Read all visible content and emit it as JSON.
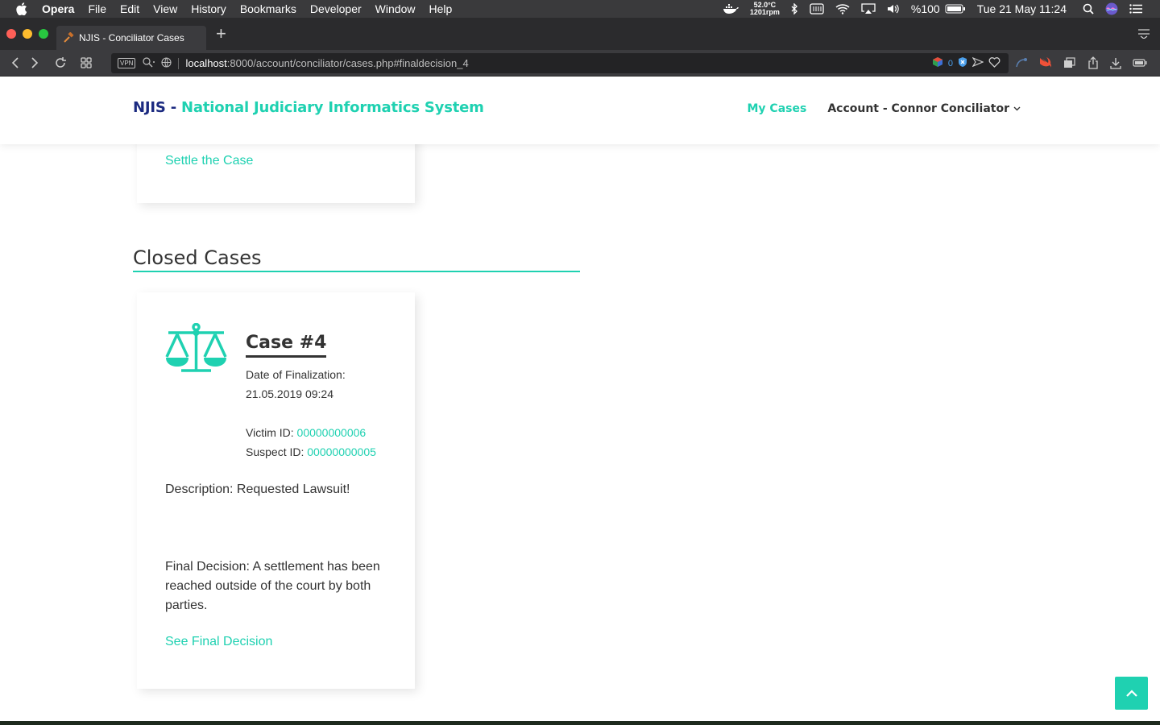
{
  "menubar": {
    "app": "Opera",
    "items": [
      "File",
      "Edit",
      "View",
      "History",
      "Bookmarks",
      "Developer",
      "Window",
      "Help"
    ],
    "temp": "52.0°C",
    "rpm": "1201rpm",
    "battery": "%100",
    "clock": "Tue 21 May  11:24"
  },
  "browser": {
    "tab_title": "NJIS - Conciliator Cases",
    "vpn": "VPN",
    "url_host": "localhost",
    "url_path": ":8000/account/conciliator/cases.php#finaldecision_4",
    "ext_count": "0"
  },
  "site": {
    "brand_short": "NJIS",
    "brand_dash": " - ",
    "brand_full": "National Judiciary Informatics System",
    "nav_my_cases": "My Cases",
    "nav_account": "Account - Connor Conciliator"
  },
  "previous_card": {
    "settle_link": "Settle the Case"
  },
  "closed_section": {
    "title": "Closed Cases",
    "case": {
      "title": "Case #4",
      "finalization_label": "Date of Finalization:",
      "finalization_date": "21.05.2019 09:24",
      "victim_label": "Victim ID: ",
      "victim_id": "00000000006",
      "suspect_label": "Suspect ID: ",
      "suspect_id": "00000000005",
      "description": "Description: Requested Lawsuit!",
      "final_decision": "Final Decision: A settlement has been reached outside of the court by both parties.",
      "see_final_link": "See Final Decision"
    }
  },
  "colors": {
    "accent": "#1fd1b1",
    "brand_navy": "#1b2a80"
  }
}
